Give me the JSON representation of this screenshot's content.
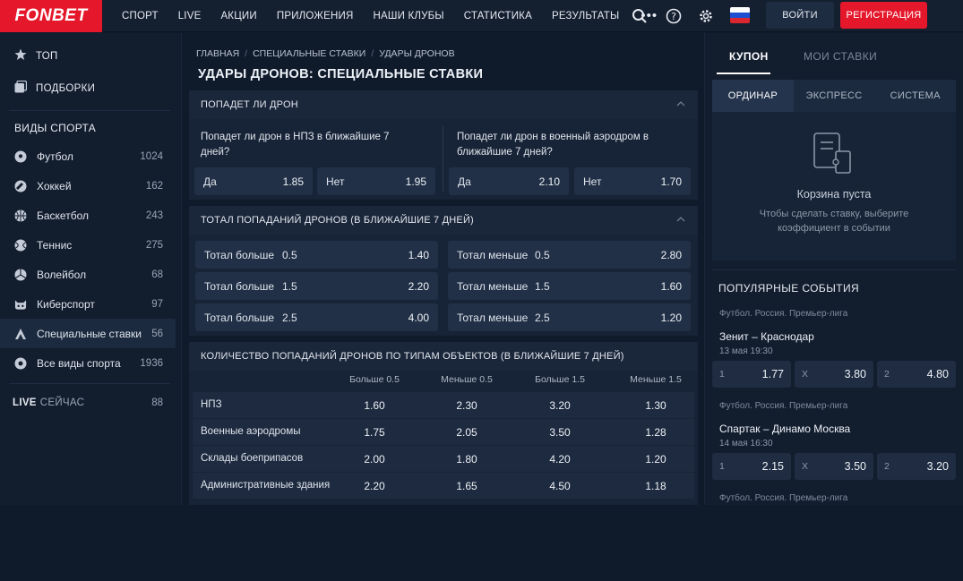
{
  "header": {
    "logo": "FONBET",
    "nav": [
      "СПОРТ",
      "LIVE",
      "АКЦИИ",
      "ПРИЛОЖЕНИЯ",
      "НАШИ КЛУБЫ",
      "СТАТИСТИКА",
      "РЕЗУЛЬТАТЫ"
    ],
    "more": "•••",
    "login": "ВОЙТИ",
    "register": "РЕГИСТРАЦИЯ",
    "icons": [
      "search-icon",
      "help-icon",
      "settings-icon",
      "russia-flag-icon"
    ],
    "brand_color": "#e4172b"
  },
  "sidebar": {
    "top": [
      {
        "icon": "star-icon",
        "label": "ТОП"
      },
      {
        "icon": "collections-icon",
        "label": "ПОДБОРКИ"
      }
    ],
    "sports_heading": "ВИДЫ СПОРТА",
    "sports": [
      {
        "icon": "football-icon",
        "name": "Футбол",
        "count": "1024"
      },
      {
        "icon": "hockey-icon",
        "name": "Хоккей",
        "count": "162"
      },
      {
        "icon": "basketball-icon",
        "name": "Баскетбол",
        "count": "243"
      },
      {
        "icon": "tennis-icon",
        "name": "Теннис",
        "count": "275"
      },
      {
        "icon": "volleyball-icon",
        "name": "Волейбол",
        "count": "68"
      },
      {
        "icon": "esports-icon",
        "name": "Киберспорт",
        "count": "97"
      },
      {
        "icon": "special-bets-icon",
        "name": "Специальные ставки",
        "count": "56"
      },
      {
        "icon": "all-sports-icon",
        "name": "Все виды спорта",
        "count": "1936"
      }
    ],
    "live": {
      "label_bold": "LIVE",
      "label": "СЕЙЧАС",
      "count": "88"
    }
  },
  "main": {
    "breadcrumbs": [
      "ГЛАВНАЯ",
      "СПЕЦИАЛЬНЫЕ СТАВКИ",
      "УДАРЫ ДРОНОВ"
    ],
    "title": "УДАРЫ ДРОНОВ: СПЕЦИАЛЬНЫЕ СТАВКИ",
    "section1": {
      "title": "ПОПАДЕТ ЛИ ДРОН",
      "questions": [
        {
          "text": "Попадет ли дрон в НПЗ в ближайшие 7 дней?",
          "odds": [
            {
              "k": "Да",
              "v": "1.85"
            },
            {
              "k": "Нет",
              "v": "1.95"
            }
          ]
        },
        {
          "text": "Попадет ли дрон в военный аэродром в ближайшие 7 дней?",
          "odds": [
            {
              "k": "Да",
              "v": "2.10"
            },
            {
              "k": "Нет",
              "v": "1.70"
            }
          ]
        }
      ]
    },
    "section2": {
      "title": "ТОТАЛ ПОПАДАНИЙ ДРОНОВ (В БЛИЖАЙШИЕ 7 ДНЕЙ)",
      "rows": [
        [
          {
            "k": "Тотал больше",
            "t": "0.5",
            "v": "1.40"
          },
          {
            "k": "Тотал меньше",
            "t": "0.5",
            "v": "2.80"
          }
        ],
        [
          {
            "k": "Тотал больше",
            "t": "1.5",
            "v": "2.20"
          },
          {
            "k": "Тотал меньше",
            "t": "1.5",
            "v": "1.60"
          }
        ],
        [
          {
            "k": "Тотал больше",
            "t": "2.5",
            "v": "4.00"
          },
          {
            "k": "Тотал меньше",
            "t": "2.5",
            "v": "1.20"
          }
        ]
      ]
    },
    "section3": {
      "title": "КОЛИЧЕСТВО ПОПАДАНИЙ ДРОНОВ ПО ТИПАМ ОБЪЕКТОВ (В БЛИЖАЙШИЕ 7 ДНЕЙ)",
      "columns": [
        "Больше 0.5",
        "Меньше 0.5",
        "Больше 1.5",
        "Меньше 1.5"
      ],
      "rows": [
        {
          "name": "НПЗ",
          "values": [
            "1.60",
            "2.30",
            "3.20",
            "1.30"
          ]
        },
        {
          "name": "Военные аэродромы",
          "values": [
            "1.75",
            "2.05",
            "3.50",
            "1.28"
          ]
        },
        {
          "name": "Склады боеприпасов",
          "values": [
            "2.00",
            "1.80",
            "4.20",
            "1.20"
          ]
        },
        {
          "name": "Административные здания",
          "values": [
            "2.20",
            "1.65",
            "4.50",
            "1.18"
          ]
        }
      ]
    }
  },
  "coupon": {
    "tabs": [
      "КУПОН",
      "МОИ СТАВКИ"
    ],
    "modes": [
      "ОРДИНАР",
      "ЭКСПРЕСС",
      "СИСТЕМА"
    ],
    "empty_title": "Корзина пуста",
    "empty_sub": "Чтобы сделать ставку, выберите коэффициент в событии",
    "popular_title": "ПОПУЛЯРНЫЕ СОБЫТИЯ",
    "events": [
      {
        "league": "Футбол. Россия. Премьер-лига",
        "teams": "Зенит – Краснодар",
        "date": "13 мая 19:30",
        "odds": [
          {
            "k": "1",
            "v": "1.77"
          },
          {
            "k": "X",
            "v": "3.80"
          },
          {
            "k": "2",
            "v": "4.80"
          }
        ]
      },
      {
        "league": "Футбол. Россия. Премьер-лига",
        "teams": "Спартак – Динамо Москва",
        "date": "14 мая 16:30",
        "odds": [
          {
            "k": "1",
            "v": "2.15"
          },
          {
            "k": "X",
            "v": "3.50"
          },
          {
            "k": "2",
            "v": "3.20"
          }
        ]
      },
      {
        "league": "Футбол. Россия. Премьер-лига"
      }
    ]
  }
}
